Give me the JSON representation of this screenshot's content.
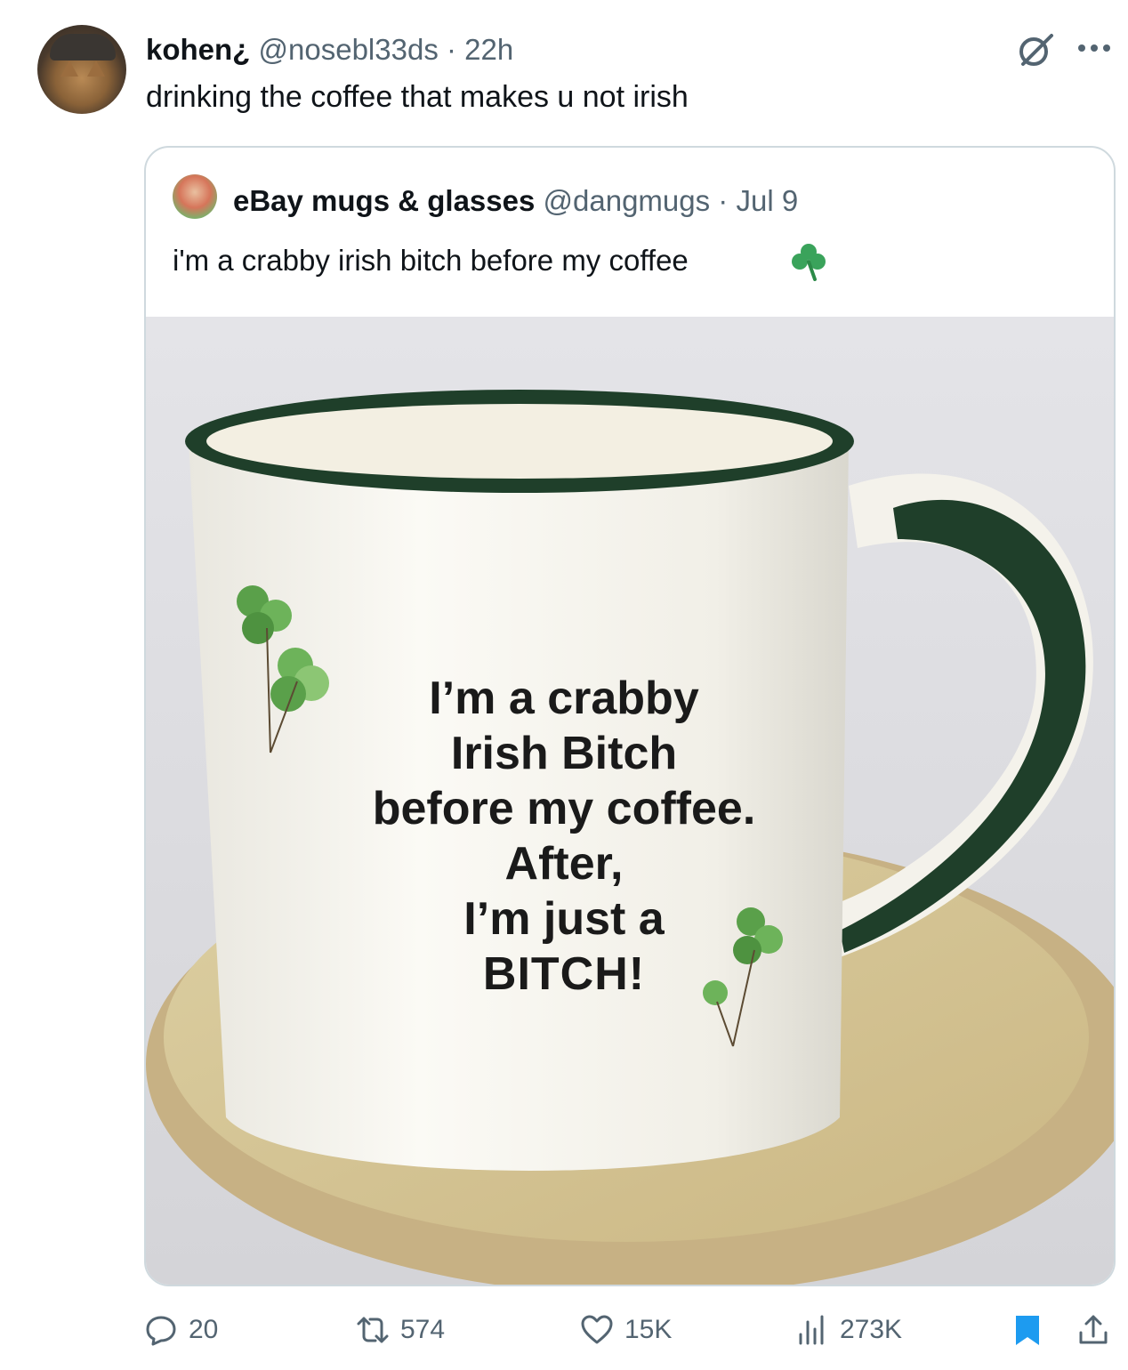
{
  "tweet": {
    "author_name": "kohen¿",
    "handle": "@nosebl33ds",
    "separator": "·",
    "time": "22h",
    "text": "drinking the coffee that makes u not irish"
  },
  "quoted": {
    "author_name": "eBay mugs & glasses",
    "handle": "@dangmugs",
    "separator": "·",
    "time": "Jul 9",
    "text": "i'm a crabby irish bitch before my coffee",
    "emoji": "shamrock",
    "image": {
      "mug_lines": [
        "I’m a crabby",
        "Irish Bitch",
        "before my coffee.",
        "After,",
        "I’m just a",
        "BITCH!"
      ]
    }
  },
  "actions": {
    "replies": "20",
    "reposts": "574",
    "likes": "15K",
    "views": "273K"
  },
  "colors": {
    "text_primary": "#0f1419",
    "text_secondary": "#536471",
    "border": "#cfd9de",
    "bookmark_active": "#1d9bf0",
    "mug_green": "#1f3f2a"
  },
  "icons": [
    "grok-icon",
    "more-icon",
    "reply-icon",
    "repost-icon",
    "like-icon",
    "views-icon",
    "bookmark-icon",
    "share-icon",
    "shamrock-icon"
  ]
}
